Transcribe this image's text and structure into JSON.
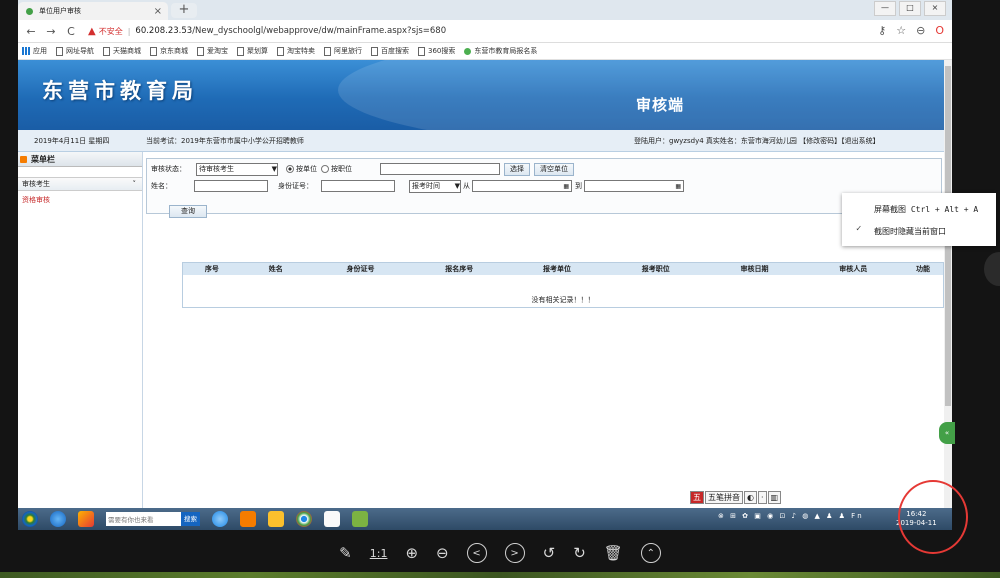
{
  "browser": {
    "tab_title": "单位用户审核",
    "tab_close": "×",
    "new_tab": "+",
    "window_controls": [
      "—",
      "□",
      "×"
    ],
    "security": "不安全",
    "url_host": "60.208.23.53",
    "url_path": "/New_dyschoolgl/webapprove/dw/mainFrame.aspx?sjs=680",
    "bookmarks": [
      "应用",
      "网址导航",
      "天猫商城",
      "京东商城",
      "爱淘宝",
      "聚划算",
      "淘宝特卖",
      "阿里旅行",
      "百度搜索",
      "360搜索",
      "东营市教育局报名系"
    ]
  },
  "header": {
    "logo": "东营市教育局",
    "side": "审核端"
  },
  "infobar": {
    "date": "2019年4月11日 星期四",
    "exam": "当前考试：2019年东营市市属中小学公开招聘教师",
    "user": "登陆用户：gwyzsdy4   真实姓名：东营市海河幼儿园   【修改密码】【退出系统】"
  },
  "menu": {
    "title": "菜单栏",
    "group": "审核考生",
    "item": "资格审核"
  },
  "filter": {
    "status_label": "审核状态：",
    "status_value": "待审核考生",
    "radio_unit": "按单位",
    "radio_position": "按职位",
    "select_btn": "选择",
    "clear_btn": "清空单位",
    "name_label": "姓名：",
    "id_label": "身份证号：",
    "time_select": "报考时间",
    "from": "从",
    "to": "到",
    "query_btn": "查询"
  },
  "table": {
    "columns": [
      "序号",
      "姓名",
      "身份证号",
      "报名序号",
      "报考单位",
      "报考职位",
      "审核日期",
      "审核人员",
      "功能"
    ],
    "empty": "没有相关记录！！！"
  },
  "context_menu": {
    "item1": "屏幕截图 Ctrl + Alt + A",
    "item2": "截图时隐藏当前窗口"
  },
  "ime": {
    "label": "五笔拼音"
  },
  "taskbar": {
    "search_placeholder": "需要有你也来看",
    "search_btn": "搜索",
    "time": "16:42",
    "date": "2019-04-11"
  },
  "viewer": {
    "ratio": "1:1"
  }
}
